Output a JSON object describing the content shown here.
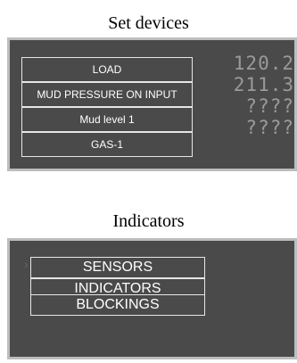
{
  "captions": {
    "top": "Set devices",
    "bottom": "Indicators"
  },
  "set_devices": {
    "items": [
      {
        "label": "LOAD"
      },
      {
        "label": "MUD PRESSURE ON INPUT"
      },
      {
        "label": "Mud level 1"
      },
      {
        "label": "GAS-1"
      }
    ],
    "readouts": [
      "120.2",
      "211.3",
      "????",
      "????"
    ]
  },
  "indicators": {
    "items": [
      {
        "label": "SENSORS"
      },
      {
        "label": "INDICATORS"
      },
      {
        "label": "BLOCKINGS"
      }
    ]
  },
  "colors": {
    "panel_bg": "#4a4a4a",
    "panel_border": "#bdbdbd",
    "menu_text": "#ffffff",
    "readout_text": "#9a9a9a"
  }
}
